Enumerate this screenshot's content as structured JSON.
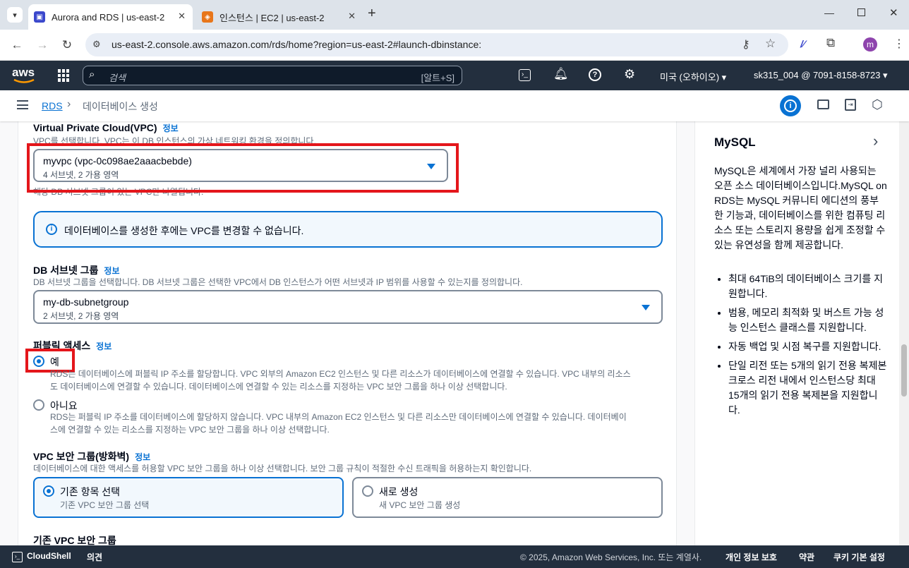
{
  "browser": {
    "tabs": [
      {
        "title": "Aurora and RDS | us-east-2",
        "active": true
      },
      {
        "title": "인스턴스 | EC2 | us-east-2",
        "active": false
      }
    ],
    "url": "us-east-2.console.aws.amazon.com/rds/home?region=us-east-2#launch-dbinstance:",
    "profile_initial": "m"
  },
  "aws_header": {
    "logo": "aws",
    "search_placeholder": "검색",
    "search_shortcut": "[알트+S]",
    "region": "미국 (오하이오) ▾",
    "account": "sk315_004 @ 7091-8158-8723 ▾"
  },
  "breadcrumb": {
    "root": "RDS",
    "current": "데이터베이스 생성"
  },
  "vpc": {
    "label": "Virtual Private Cloud(VPC)",
    "info": "정보",
    "description": "VPC를 선택합니다. VPC는 이 DB 인스턴스의 가상 네트워킹 환경을 정의합니다.",
    "selected": "myvpc (vpc-0c098ae2aaacbebde)",
    "selected_detail": "4 서브넷, 2 가용 영역",
    "hint": "해당 DB 서브넷 그룹이 있는 VPC만 나열됩니다.",
    "alert": "데이터베이스를 생성한 후에는 VPC를 변경할 수 없습니다."
  },
  "subnet_group": {
    "label": "DB 서브넷 그룹",
    "info": "정보",
    "description": "DB 서브넷 그룹을 선택합니다. DB 서브넷 그룹은 선택한 VPC에서 DB 인스턴스가 어떤 서브넷과 IP 범위를 사용할 수 있는지를 정의합니다.",
    "selected": "my-db-subnetgroup",
    "selected_detail": "2 서브넷, 2 가용 영역"
  },
  "public_access": {
    "label": "퍼블릭 액세스",
    "info": "정보",
    "yes_label": "예",
    "yes_desc_1": "RDS는 데이터베이스에 퍼블릭 IP 주소를 할당합니다. VPC 외부의 Amazon EC2 인스턴스 및 다른 리소스가 데이터베이스에 연결할 수 있습니다. VPC 내부의 리소스",
    "yes_desc_2": "도 데이터베이스에 연결할 수 있습니다. 데이터베이스에 연결할 수 있는 리소스를 지정하는 VPC 보안 그룹을 하나 이상 선택합니다.",
    "no_label": "아니요",
    "no_desc_1": "RDS는 퍼블릭 IP 주소를 데이터베이스에 할당하지 않습니다. VPC 내부의 Amazon EC2 인스턴스 및 다른 리소스만 데이터베이스에 연결할 수 있습니다. 데이터베이",
    "no_desc_2": "스에 연결할 수 있는 리소스를 지정하는 VPC 보안 그룹을 하나 이상 선택합니다.",
    "selected": "yes"
  },
  "security_group": {
    "label": "VPC 보안 그룹(방화벽)",
    "info": "정보",
    "description": "데이터베이스에 대한 액세스를 허용할 VPC 보안 그룹을 하나 이상 선택합니다. 보안 그룹 규칙이 적절한 수신 트래픽을 허용하는지 확인합니다.",
    "existing_title": "기존 항목 선택",
    "existing_desc": "기존 VPC 보안 그룹 선택",
    "new_title": "새로 생성",
    "new_desc": "새 VPC 보안 그룹 생성",
    "selected": "existing"
  },
  "existing_sg_label": "기존 VPC 보안 그룹",
  "help_panel": {
    "title": "MySQL",
    "body": "MySQL은 세계에서 가장 널리 사용되는 오픈 소스 데이터베이스입니다.MySQL on RDS는 MySQL 커뮤니티 에디션의 풍부한 기능과, 데이터베이스를 위한 컴퓨팅 리소스 또는 스토리지 용량을 쉽게 조정할 수 있는 유연성을 함께 제공합니다.",
    "bullets": [
      "최대 64TiB의 데이터베이스 크기를 지원합니다.",
      "범용, 메모리 최적화 및 버스트 가능 성능 인스턴스 클래스를 지원합니다.",
      "자동 백업 및 시점 복구를 지원합니다.",
      "단일 리전 또는 5개의 읽기 전용 복제본 크로스 리전 내에서 인스턴스당 최대 15개의 읽기 전용 복제본을 지원합니다."
    ]
  },
  "footer": {
    "cloudshell": "CloudShell",
    "feedback": "의견",
    "copyright": "© 2025, Amazon Web Services, Inc. 또는 계열사.",
    "privacy": "개인 정보 보호",
    "terms": "약관",
    "cookies": "쿠키 기본 설정"
  },
  "colors": {
    "accent": "#0972d3",
    "highlight": "#e4161b",
    "header": "#232f3e"
  }
}
